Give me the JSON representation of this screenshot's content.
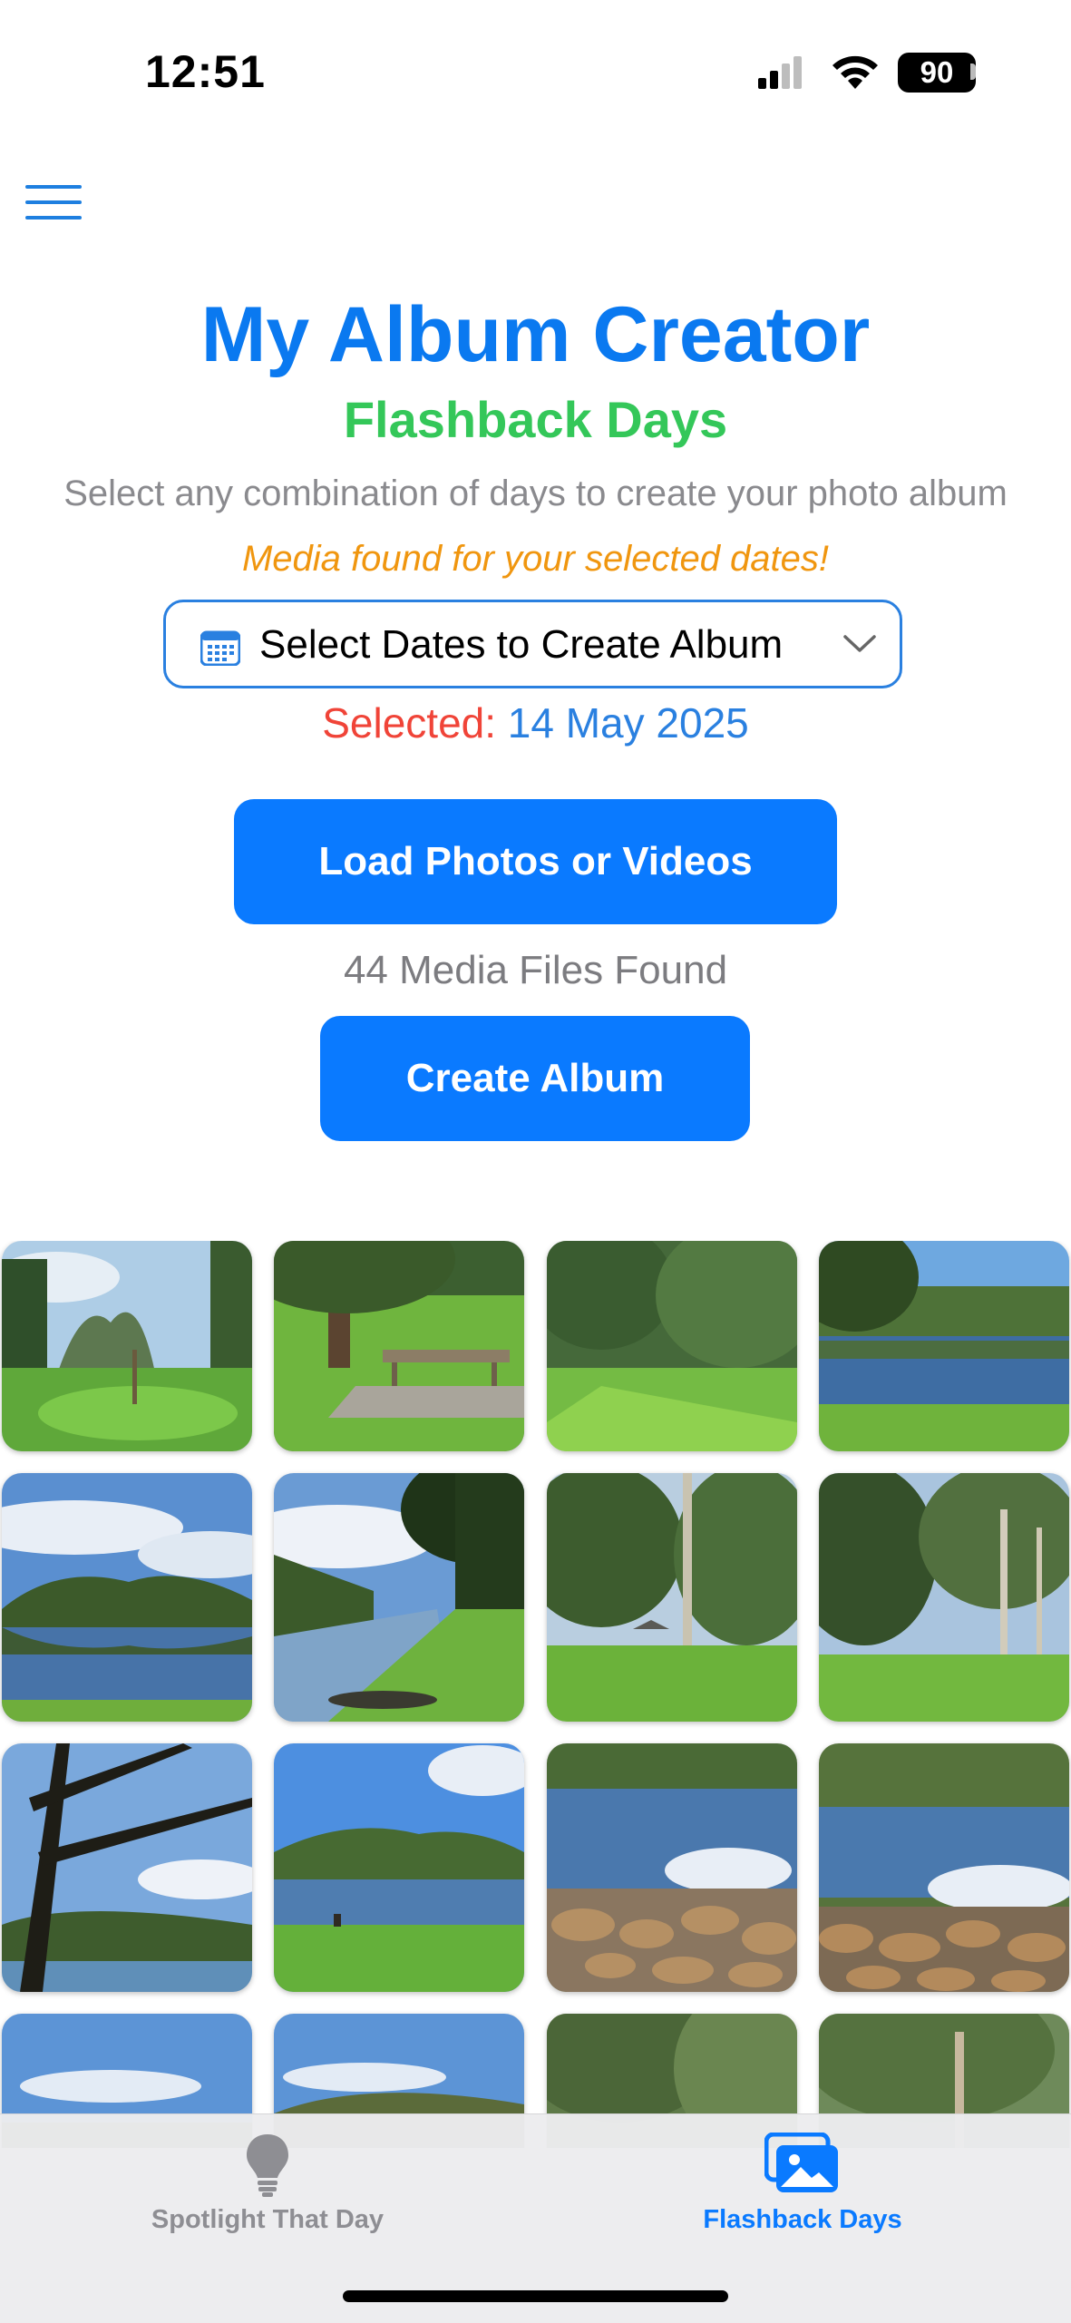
{
  "status_bar": {
    "time": "12:51",
    "battery": "90"
  },
  "header": {
    "title": "My Album Creator",
    "subtitle": "Flashback Days",
    "description": "Select any combination of days to create your photo album",
    "media_found_note": "Media found for your selected dates!"
  },
  "date_select": {
    "label": "Select Dates to Create Album",
    "icon": "calendar-icon"
  },
  "selected": {
    "label": "Selected:",
    "value": "14 May 2025"
  },
  "buttons": {
    "load": "Load Photos or Videos",
    "create": "Create Album"
  },
  "media_count": "44 Media Files Found",
  "colors": {
    "accent": "#0a7aff",
    "title": "#0a79f0",
    "subtitle": "#34c759",
    "note": "#f0960f",
    "selected_label": "#f04438"
  },
  "photos": [
    {
      "scene": "park-young-tree"
    },
    {
      "scene": "park-picnic-table"
    },
    {
      "scene": "park-lawn-trees"
    },
    {
      "scene": "lake-cliff"
    },
    {
      "scene": "lake-reflection"
    },
    {
      "scene": "lake-tree-bank"
    },
    {
      "scene": "park-shelter"
    },
    {
      "scene": "park-tall-trees"
    },
    {
      "scene": "tree-silhouette"
    },
    {
      "scene": "lake-grass-bank"
    },
    {
      "scene": "lake-rocks"
    },
    {
      "scene": "lake-rocks-2"
    },
    {
      "scene": "sky-partial"
    },
    {
      "scene": "lake-partial"
    },
    {
      "scene": "forest-partial"
    },
    {
      "scene": "forest-partial-2"
    }
  ],
  "tabs": [
    {
      "label": "Spotlight That Day",
      "icon": "lightbulb-icon",
      "active": false
    },
    {
      "label": "Flashback Days",
      "icon": "photos-icon",
      "active": true
    }
  ]
}
